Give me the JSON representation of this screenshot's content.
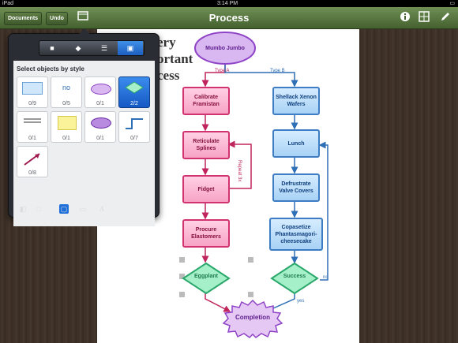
{
  "status_bar": {
    "device": "iPad",
    "time": "3:14 PM",
    "battery": "▭"
  },
  "toolbar": {
    "documents_label": "Documents",
    "undo_label": "Undo",
    "title": "Process",
    "icons": [
      "screen-icon",
      "info-icon",
      "grid-icon",
      "pencil-icon"
    ]
  },
  "canvas": {
    "background_text": [
      "ery",
      "ortant",
      "cess"
    ],
    "nodes": {
      "start": "Mumbo Jumbo",
      "calibrate": "Calibrate Framistan",
      "reticulate": "Reticulate Splines",
      "fidget": "Fidget",
      "procure": "Procure Elastomers",
      "eggplant": "Eggplant",
      "completion": "Completion",
      "shellack": "Shellack Xenon Wafers",
      "lunch": "Lunch",
      "defrustrate": "Defrustrate Valve Covers",
      "copasetize": "Copasetize Phantasmagori-cheesecake",
      "success": "Success"
    },
    "edge_labels": {
      "type_a": "Type A",
      "type_b": "Type B",
      "repeat": "Repeat 3x",
      "yes": "yes",
      "no": "no"
    }
  },
  "style_popover": {
    "heading": "Select objects by style",
    "tabs": [
      "layers-icon",
      "stack-icon",
      "list-icon",
      "group-icon"
    ],
    "active_tab": 3,
    "tiles": [
      {
        "count": "0/9",
        "kind": "blue-note"
      },
      {
        "count": "0/5",
        "kind": "text",
        "text": "no"
      },
      {
        "count": "0/1",
        "kind": "lavender-ellipse"
      },
      {
        "count": "2/2",
        "kind": "green-diamond",
        "selected": true
      },
      {
        "count": "0/1",
        "kind": "small-text"
      },
      {
        "count": "0/1",
        "kind": "yellow-note"
      },
      {
        "count": "0/1",
        "kind": "purple-ellipse"
      },
      {
        "count": "0/7",
        "kind": "blue-connector"
      },
      {
        "count": "0/8",
        "kind": "red-arrow"
      }
    ],
    "bottom_tools": [
      "fill-icon",
      "stroke-icon",
      "shadow-icon",
      "image-icon",
      "text-style-icon"
    ],
    "text_tool": "A"
  },
  "colors": {
    "toolbar": "#5a7a40",
    "pink_node": "#f7a3c6",
    "blue_node": "#a8d2f5",
    "diamond": "#a6f0c9",
    "selected_tile": "#1e6fd9"
  }
}
